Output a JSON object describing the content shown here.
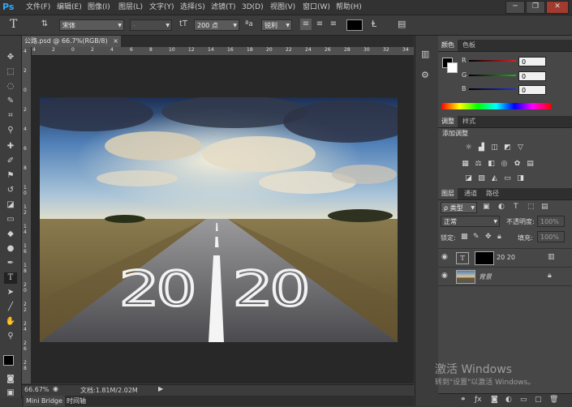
{
  "app": {
    "logo": "Ps"
  },
  "menu": {
    "items": [
      "文件(F)",
      "编辑(E)",
      "图像(I)",
      "图层(L)",
      "文字(Y)",
      "选择(S)",
      "滤镜(T)",
      "3D(D)",
      "视图(V)",
      "窗口(W)",
      "帮助(H)"
    ]
  },
  "window_controls": {
    "minimize": "─",
    "restore": "❐",
    "close": "✕"
  },
  "options_bar": {
    "tool_glyph": "T",
    "font_family": "宋体",
    "font_style": "-",
    "size_glyph": "tT",
    "font_size": "200 点",
    "aa_label": "ªa",
    "aa_mode": "锐利",
    "text_color": "#000000"
  },
  "document": {
    "tab_label": "公路.psd @ 66.7%(RGB/8)",
    "tab_close": "×",
    "ruler_top": [
      "4",
      "2",
      "0",
      "2",
      "4",
      "6",
      "8",
      "10",
      "12",
      "14",
      "16",
      "18",
      "20",
      "22",
      "24",
      "26",
      "28",
      "30",
      "32",
      "34"
    ],
    "ruler_left": [
      "4",
      "2",
      "0",
      "2",
      "4",
      "6",
      "8",
      "1 0",
      "1 2",
      "1 4",
      "1 6",
      "1 8",
      "2 0",
      "2 2",
      "2 4",
      "2 6",
      "2 8"
    ],
    "image_text": "20 20"
  },
  "status": {
    "zoom": "66.67%",
    "doc_info": "文档:1.81M/2.02M"
  },
  "bottom_tabs": [
    "Mini Bridge",
    "时间轴"
  ],
  "color_panel": {
    "tabs": [
      "颜色",
      "色板"
    ],
    "channels": [
      {
        "label": "R",
        "value": "0",
        "color": "#e02020"
      },
      {
        "label": "G",
        "value": "0",
        "color": "#20b020"
      },
      {
        "label": "B",
        "value": "0",
        "color": "#2030e0"
      }
    ]
  },
  "adjustments_panel": {
    "tabs": [
      "调整",
      "样式"
    ],
    "title": "添加调整"
  },
  "layers_panel": {
    "tabs": [
      "图层",
      "通道",
      "路径"
    ],
    "filter_kind": "ρ 类型",
    "blend_mode": "正常",
    "opacity_label": "不透明度:",
    "opacity_value": "100%",
    "lock_label": "锁定:",
    "fill_label": "填充:",
    "fill_value": "100%",
    "layers": [
      {
        "name": "20 20",
        "type": "text"
      },
      {
        "name": "背景",
        "type": "image"
      }
    ]
  },
  "watermark": {
    "line1": "激活 Windows",
    "line2": "转到\"设置\"以激活 Windows。"
  }
}
